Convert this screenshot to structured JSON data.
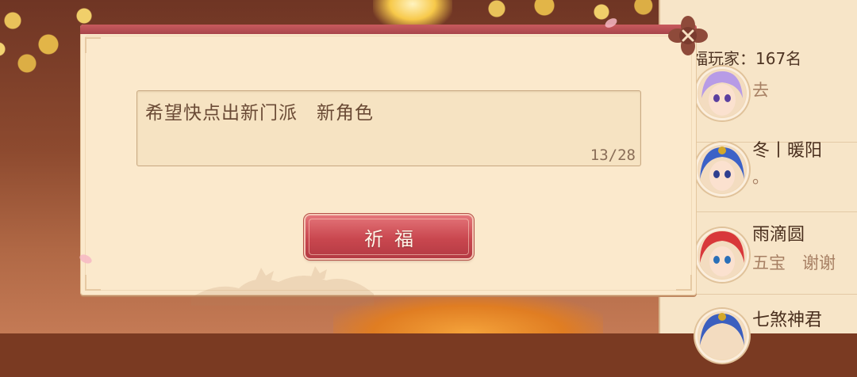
{
  "dialog": {
    "message_text": "希望快点出新门派　新角色",
    "char_count": "13/28",
    "pray_button_label": "祈福"
  },
  "panel": {
    "header": "福玩家：167名",
    "players": [
      {
        "name": "",
        "message": "去",
        "avatar_color": "#b79be6"
      },
      {
        "name": "冬丨暖阳",
        "message": "。",
        "avatar_color": "#3c62c7"
      },
      {
        "name": "雨滴圆",
        "message": "五宝　谢谢",
        "avatar_color": "#d8383a"
      },
      {
        "name": "七煞神君",
        "message": "",
        "avatar_color": "#3b5fbf"
      }
    ]
  },
  "colors": {
    "dialog_bg": "#fbe9cc",
    "button_red": "#c9474f",
    "panel_bg": "#f7e5c8"
  }
}
